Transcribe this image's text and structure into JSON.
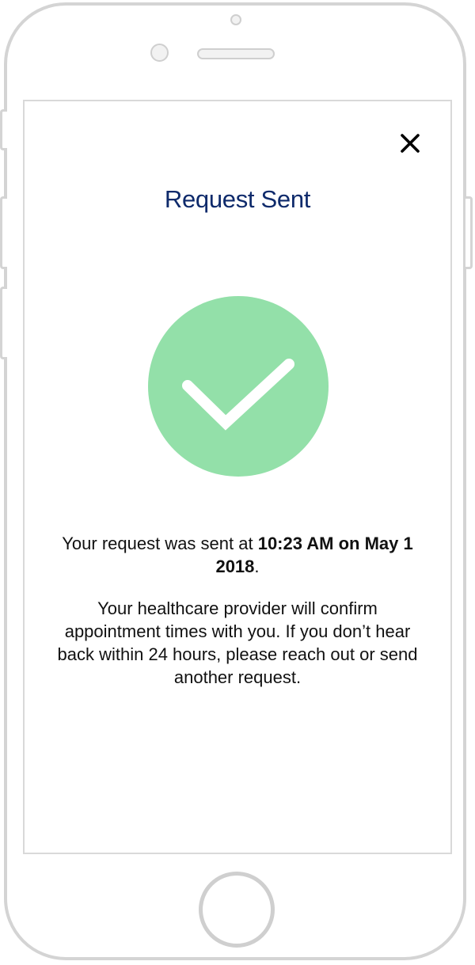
{
  "header": {
    "close_label": "✕",
    "title": "Request Sent"
  },
  "status": {
    "icon": "checkmark-icon",
    "circle_color": "#93e0a9",
    "check_color": "#ffffff"
  },
  "message": {
    "sent_prefix": "Your request was sent at ",
    "sent_datetime": "10:23 AM on May 1 2018",
    "sent_suffix": ".",
    "info": "Your healthcare provider will confirm appointment times with you. If you don’t hear back within 24 hours, please reach out or send another request."
  },
  "colors": {
    "title": "#0e2a6b",
    "text": "#111111"
  }
}
